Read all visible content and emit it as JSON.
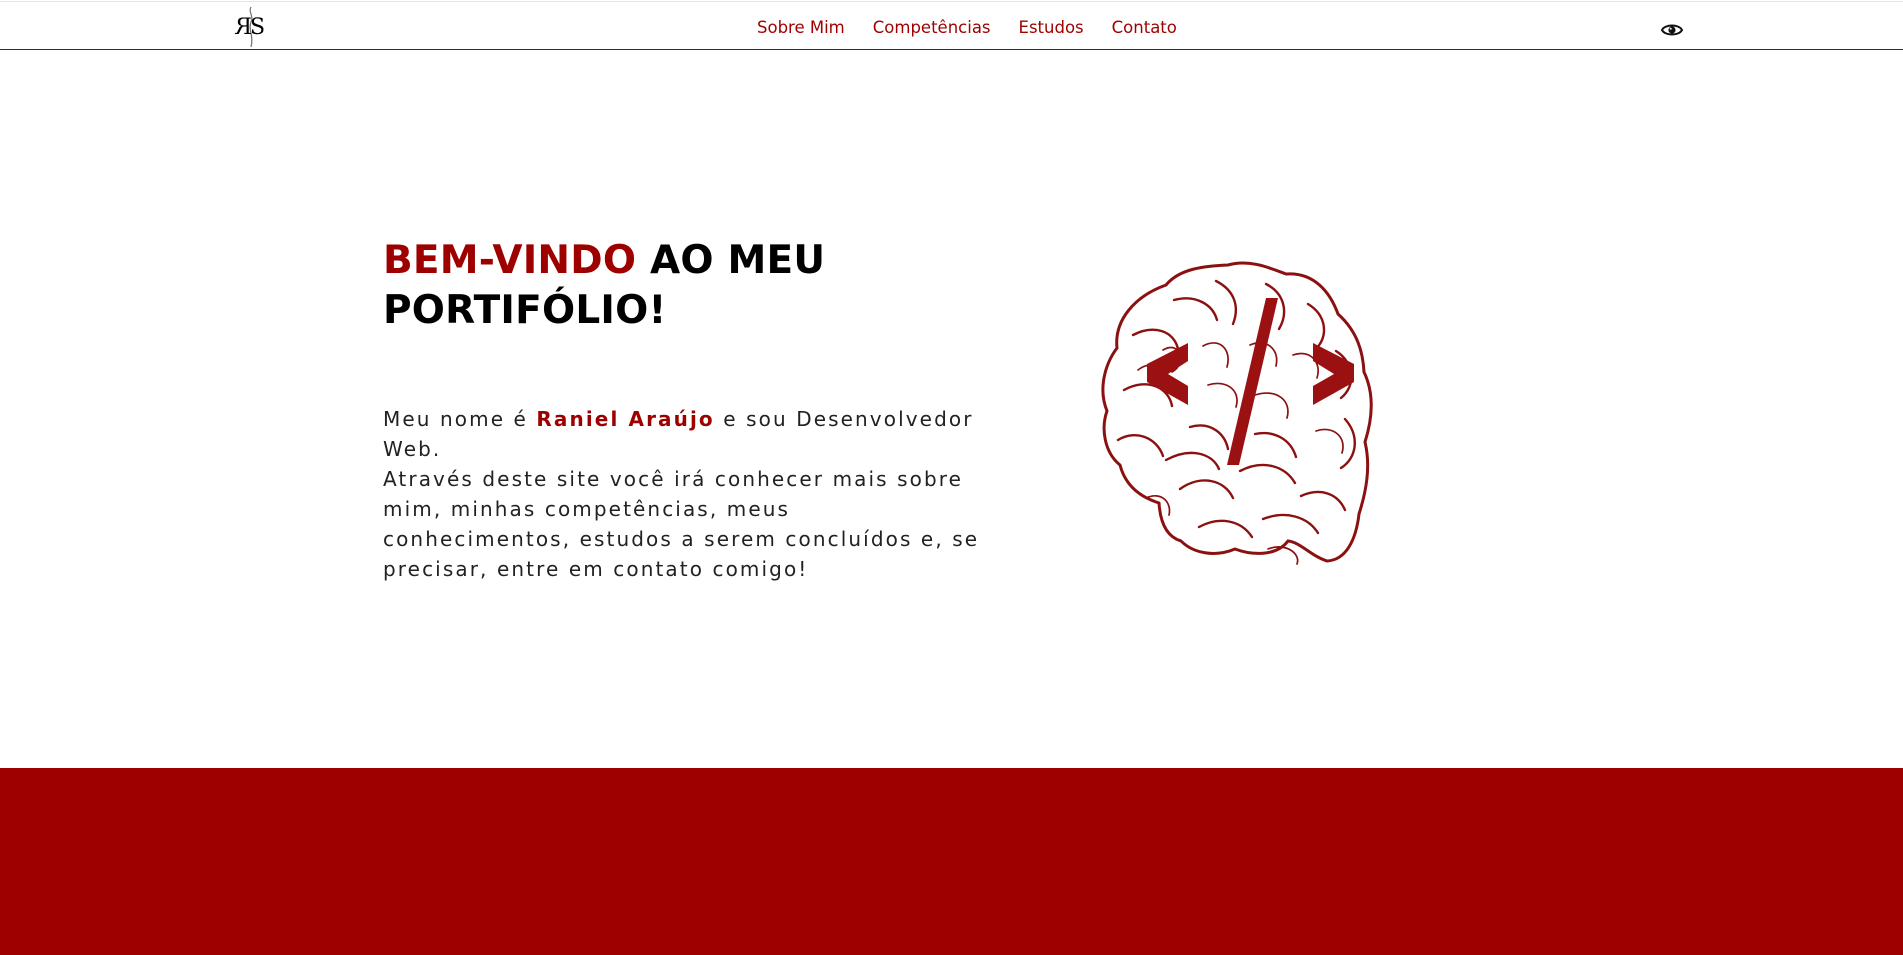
{
  "brand": {
    "logo_text": "RS",
    "accent_color": "#9e0000"
  },
  "nav": {
    "links": [
      {
        "label": "Sobre Mim"
      },
      {
        "label": "Competências"
      },
      {
        "label": "Estudos"
      },
      {
        "label": "Contato"
      }
    ],
    "accessibility_icon": "eye-icon"
  },
  "hero": {
    "title_accent": "BEM-VINDO",
    "title_rest": " AO MEU PORTIFÓLIO!",
    "intro_before_name": "Meu nome é ",
    "name": "Raniel Araújo",
    "intro_after_name": " e sou Desenvolvedor Web.",
    "description": "Através deste site você irá conhecer mais sobre mim, minhas competências, meus conhecimentos, estudos a serem concluídos e, se precisar, entre em contato comigo!",
    "illustration_icon": "brain-code-icon"
  },
  "footer_band": {
    "color": "#9e0000"
  }
}
